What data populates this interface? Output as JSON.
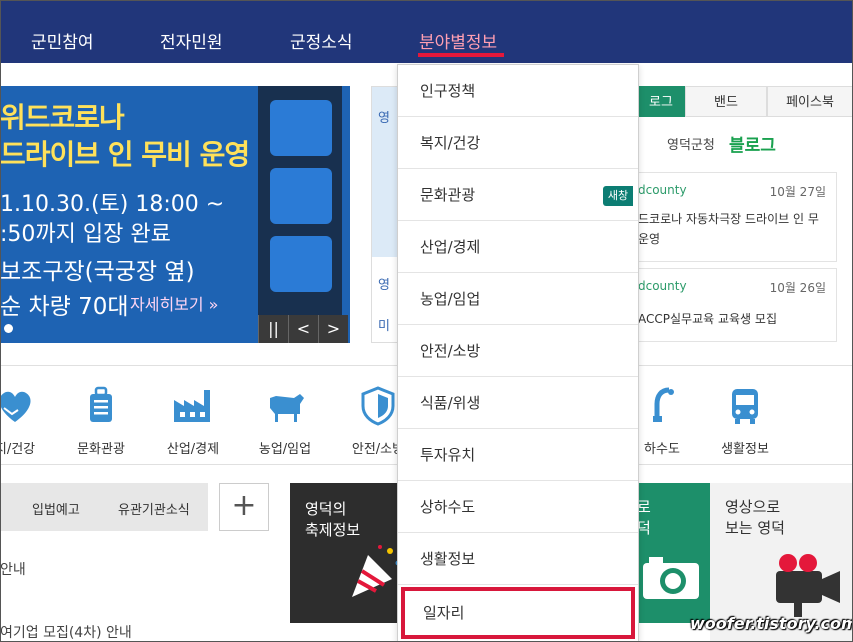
{
  "topnav": {
    "items": [
      {
        "label": "군민참여"
      },
      {
        "label": "전자민원"
      },
      {
        "label": "군정소식"
      },
      {
        "label": "분야별정보"
      }
    ]
  },
  "banner": {
    "line1": "위드코로나",
    "line2": "드라이브 인 무비 운영",
    "line3": "1.10.30.(토) 18:00 ~",
    "line4": ":50까지 입장 완료",
    "line5": "보조구장(국궁장 옆)",
    "line6": "순 차량 70대",
    "more": "자세히보기 »",
    "controls": {
      "pause": "||",
      "prev": "<",
      "next": ">"
    }
  },
  "midbox": {
    "l1": "영",
    "l2": "영",
    "l3": "미"
  },
  "social": {
    "tabs": [
      {
        "label": "로그"
      },
      {
        "label": "밴드"
      },
      {
        "label": "페이스북"
      }
    ],
    "blog_head": "영덕군청",
    "blog_logo": "블로그",
    "posts": [
      {
        "account": "dcounty",
        "date": "10월 27일",
        "title": "드코로나 자동차극장 드라이브 인 무 운영"
      },
      {
        "account": "dcounty",
        "date": "10월 26일",
        "title": "ACCP실무교육 교육생 모집"
      }
    ]
  },
  "categories": [
    {
      "label": "지/건강"
    },
    {
      "label": "문화관광"
    },
    {
      "label": "산업/경제"
    },
    {
      "label": "농업/임업"
    },
    {
      "label": "안전/소방"
    },
    {
      "label": "하수도"
    },
    {
      "label": "생활정보"
    }
  ],
  "notice": {
    "tabs": [
      {
        "label": "입법예고"
      },
      {
        "label": "유관기관소식"
      }
    ],
    "plus": "+",
    "lines": [
      "안내",
      "여기업 모집(4차) 안내"
    ]
  },
  "festival": {
    "title": "영덕의\n축제정보"
  },
  "greenbox": {
    "title": "로\n덕"
  },
  "videobox": {
    "title": "영상으로\n보는 영덕"
  },
  "dropdown": {
    "items": [
      {
        "label": "인구정책"
      },
      {
        "label": "복지/건강"
      },
      {
        "label": "문화관광"
      },
      {
        "label": "산업/경제"
      },
      {
        "label": "농업/임업"
      },
      {
        "label": "안전/소방"
      },
      {
        "label": "식품/위생"
      },
      {
        "label": "투자유치"
      },
      {
        "label": "상하수도"
      },
      {
        "label": "생활정보"
      },
      {
        "label": "일자리"
      }
    ],
    "new_badge": "새창"
  },
  "watermark": "woofer.tistory.com",
  "colors": {
    "nav_bg": "#21367a",
    "active_nav": "#ff9fb2",
    "accent_red": "#d8173b",
    "green": "#1d8f6a",
    "icon_blue": "#3a8fd0"
  }
}
